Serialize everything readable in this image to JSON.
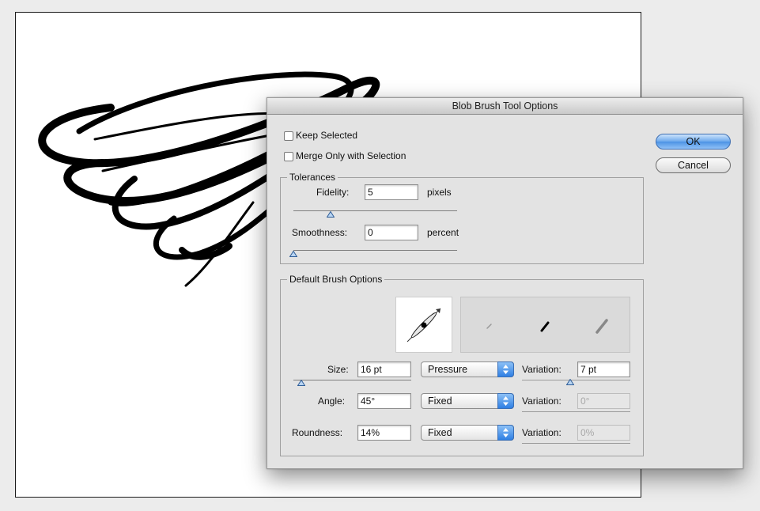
{
  "dialog": {
    "title": "Blob Brush Tool Options",
    "keep_selected": {
      "label": "Keep Selected",
      "checked": false
    },
    "merge_only": {
      "label": "Merge Only with Selection",
      "checked": false
    },
    "ok_label": "OK",
    "cancel_label": "Cancel",
    "tolerances": {
      "legend": "Tolerances",
      "fidelity": {
        "label": "Fidelity:",
        "value": "5",
        "unit": "pixels",
        "slider_fraction": 0.22
      },
      "smoothness": {
        "label": "Smoothness:",
        "value": "0",
        "unit": "percent",
        "slider_fraction": 0.0
      }
    },
    "brush": {
      "legend": "Default Brush Options",
      "size": {
        "label": "Size:",
        "value": "16 pt",
        "mode": "Pressure",
        "variation_label": "Variation:",
        "variation_value": "7 pt",
        "variation_enabled": true
      },
      "angle": {
        "label": "Angle:",
        "value": "45°",
        "mode": "Fixed",
        "variation_label": "Variation:",
        "variation_value": "0°",
        "variation_enabled": false
      },
      "roundness": {
        "label": "Roundness:",
        "value": "14%",
        "mode": "Fixed",
        "variation_label": "Variation:",
        "variation_value": "0%",
        "variation_enabled": false
      }
    }
  },
  "colors": {
    "accent": "#4c92e4",
    "dialog_bg": "#e3e3e3",
    "artboard_bg": "#ffffff",
    "stroke": "#000000"
  }
}
